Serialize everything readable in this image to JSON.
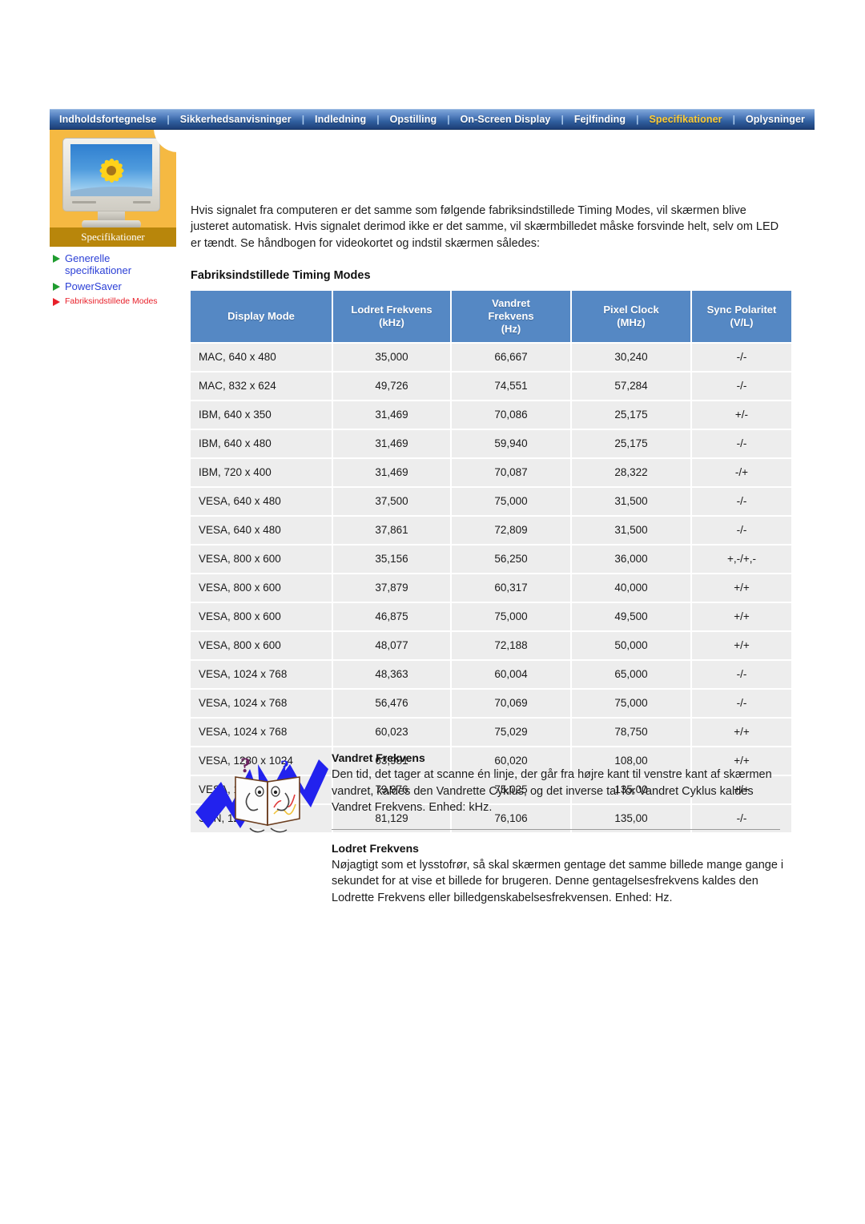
{
  "nav": {
    "separator": "|",
    "items": [
      {
        "label": "Indholdsfortegnelse",
        "active": false
      },
      {
        "label": "Sikkerhedsanvisninger",
        "active": false
      },
      {
        "label": "Indledning",
        "active": false
      },
      {
        "label": "Opstilling",
        "active": false
      },
      {
        "label": "On-Screen Display",
        "active": false
      },
      {
        "label": "Fejlfinding",
        "active": false
      },
      {
        "label": "Specifikationer",
        "active": true
      },
      {
        "label": "Oplysninger",
        "active": false
      }
    ]
  },
  "sidebar": {
    "section_label": "Specifikationer",
    "image_name": "monitor-sunflower-image",
    "links": [
      {
        "label": "Generelle specifikationer",
        "active": false,
        "arrow": "green"
      },
      {
        "label": "PowerSaver",
        "active": false,
        "arrow": "green"
      },
      {
        "label": "Fabriksindstillede Modes",
        "active": true,
        "arrow": "red"
      }
    ]
  },
  "main": {
    "intro": "Hvis signalet fra computeren er det samme som følgende fabriksindstillede Timing Modes, vil skærmen blive justeret automatisk. Hvis signalet derimod ikke er det samme, vil skærmbilledet måske forsvinde helt, selv om LED er tændt. Se håndbogen for videokortet og indstil skærmen således:",
    "table_title": "Fabriksindstillede Timing Modes"
  },
  "table": {
    "headers": [
      {
        "line1": "Display Mode",
        "line2": ""
      },
      {
        "line1": "Lodret Frekvens",
        "line2": "(kHz)"
      },
      {
        "line1": "Vandret",
        "line2": "Frekvens",
        "line3": "(Hz)"
      },
      {
        "line1": "Pixel Clock",
        "line2": "(MHz)"
      },
      {
        "line1": "Sync Polaritet",
        "line2": "(V/L)"
      }
    ],
    "rows": [
      {
        "mode": "MAC, 640 x 480",
        "vfreq": "35,000",
        "hfreq": "66,667",
        "clock": "30,240",
        "pol": "-/-"
      },
      {
        "mode": "MAC, 832 x 624",
        "vfreq": "49,726",
        "hfreq": "74,551",
        "clock": "57,284",
        "pol": "-/-"
      },
      {
        "mode": "IBM, 640 x 350",
        "vfreq": "31,469",
        "hfreq": "70,086",
        "clock": "25,175",
        "pol": "+/-"
      },
      {
        "mode": "IBM, 640 x 480",
        "vfreq": "31,469",
        "hfreq": "59,940",
        "clock": "25,175",
        "pol": "-/-"
      },
      {
        "mode": "IBM, 720 x 400",
        "vfreq": "31,469",
        "hfreq": "70,087",
        "clock": "28,322",
        "pol": "-/+"
      },
      {
        "mode": "VESA, 640 x 480",
        "vfreq": "37,500",
        "hfreq": "75,000",
        "clock": "31,500",
        "pol": "-/-"
      },
      {
        "mode": "VESA, 640 x 480",
        "vfreq": "37,861",
        "hfreq": "72,809",
        "clock": "31,500",
        "pol": "-/-"
      },
      {
        "mode": "VESA, 800 x 600",
        "vfreq": "35,156",
        "hfreq": "56,250",
        "clock": "36,000",
        "pol": "+,-/+,-"
      },
      {
        "mode": "VESA, 800 x 600",
        "vfreq": "37,879",
        "hfreq": "60,317",
        "clock": "40,000",
        "pol": "+/+"
      },
      {
        "mode": "VESA, 800 x 600",
        "vfreq": "46,875",
        "hfreq": "75,000",
        "clock": "49,500",
        "pol": "+/+"
      },
      {
        "mode": "VESA, 800 x 600",
        "vfreq": "48,077",
        "hfreq": "72,188",
        "clock": "50,000",
        "pol": "+/+"
      },
      {
        "mode": "VESA, 1024 x 768",
        "vfreq": "48,363",
        "hfreq": "60,004",
        "clock": "65,000",
        "pol": "-/-"
      },
      {
        "mode": "VESA, 1024 x 768",
        "vfreq": "56,476",
        "hfreq": "70,069",
        "clock": "75,000",
        "pol": "-/-"
      },
      {
        "mode": "VESA, 1024 x 768",
        "vfreq": "60,023",
        "hfreq": "75,029",
        "clock": "78,750",
        "pol": "+/+"
      },
      {
        "mode": "VESA, 1280 x 1024",
        "vfreq": "63,981",
        "hfreq": "60,020",
        "clock": "108,00",
        "pol": "+/+"
      },
      {
        "mode": "VESA, 1280 x 1024",
        "vfreq": "79,976",
        "hfreq": "75,025",
        "clock": "135,00",
        "pol": "+/+"
      },
      {
        "mode": "SUN, 1280 x 1024",
        "vfreq": "81,129",
        "hfreq": "76,106",
        "clock": "135,00",
        "pol": "-/-"
      }
    ]
  },
  "notes": {
    "icon_name": "open-book-question-icon",
    "horizontal": {
      "title": "Vandret Frekvens",
      "text": "Den tid, det tager at scanne én linje, der går fra højre kant til venstre kant af skærmen vandret, kaldes den Vandrette Cyklus, og det inverse tal for Vandret Cyklus kaldes Vandret Frekvens. Enhed: kHz."
    },
    "vertical": {
      "title": "Lodret Frekvens",
      "text": "Nøjagtigt som et lysstofrør, så skal skærmen gentage det samme billede mange gange i sekundet for at vise et billede for brugeren. Denne gentagelsesfrekvens kaldes den Lodrette Frekvens eller billedgenskabelsesfrekvensen. Enhed: Hz."
    }
  },
  "colors": {
    "nav_active": "#ffcc33",
    "table_header": "#5588c4",
    "table_row": "#ededed",
    "sidebar_bg": "#f5b942",
    "sidebar_label_bg": "#b8860b",
    "link": "#2b3fd6",
    "active_link": "#e8202a"
  }
}
